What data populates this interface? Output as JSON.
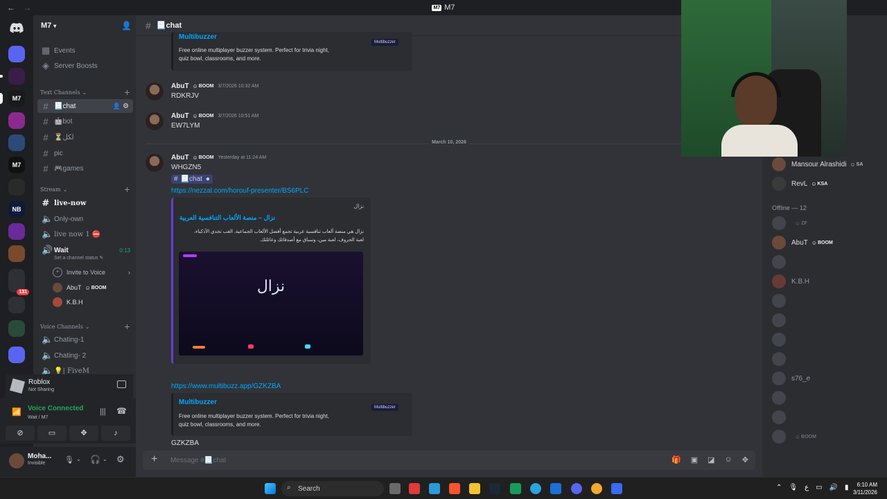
{
  "window": {
    "title": "M7",
    "back": "←",
    "forward": "→"
  },
  "server": {
    "name": "M7"
  },
  "sidebar": {
    "top_items": [
      {
        "label": "Events"
      },
      {
        "label": "Server Boosts"
      }
    ],
    "text_category": "Text Channels",
    "text_channels": [
      {
        "label": "📃chat"
      },
      {
        "label": "🤖bot"
      },
      {
        "label": "⏳لكل"
      },
      {
        "label": "pic"
      },
      {
        "label": "🎮games"
      }
    ],
    "stream_category": "Stream",
    "stream_channels": [
      {
        "label": "live-now"
      },
      {
        "label": "Only-own"
      },
      {
        "label": "live now 1 ⛔"
      },
      {
        "label": "Wait",
        "timer": "0:13"
      }
    ],
    "channel_status": "Set a channel status ✎",
    "invite_to_voice": "Invite to Voice",
    "voice_users": [
      {
        "name": "AbuT",
        "tag": "BOOM"
      },
      {
        "name": "K.B.H"
      }
    ],
    "voice_category": "Voice Channels",
    "voice_channels": [
      {
        "label": "Chating-1"
      },
      {
        "label": "Chating- 2"
      },
      {
        "label": "💡| FiveM"
      }
    ]
  },
  "activity": {
    "title": "Roblox",
    "status": "Not Sharing"
  },
  "voice": {
    "status": "Voice Connected",
    "location": "Wait / M7"
  },
  "user": {
    "name": "Moha...",
    "status": "Invisible"
  },
  "chat": {
    "channel": "📃chat",
    "top_embed": {
      "title": "Multibuzzer",
      "desc1": "Free online multiplayer buzzer system. Perfect for trivia night,",
      "desc2": "quiz bowl, classrooms, and more.",
      "logo": "Multibuzzer"
    },
    "messages": [
      {
        "author": "AbuT",
        "tag": "BOOM",
        "time": "3/7/2026 10:32 AM",
        "text": "RDKRJV"
      },
      {
        "author": "AbuT",
        "tag": "BOOM",
        "time": "3/7/2026 10:51 AM",
        "text": "EW7LYM"
      },
      {
        "author": "AbuT",
        "tag": "BOOM",
        "time": "Yesterday at 11:24 AM",
        "text": "WHGZN5"
      }
    ],
    "date_divider": "March 10, 2026",
    "channel_mention": "📃chat",
    "link1": "https://nezzal.com/horouf-presenter/BS6PLC",
    "nezzal_embed": {
      "provider": "نزال",
      "title": "نزال – منصة الألعاب التنافسية العربية",
      "desc1": "نزال هي منصة ألعاب تنافسية عربية تجمع أفضل الألعاب الجماعية. العب تحدي الأذكياء،",
      "desc2": "لعبة الحروف، لعبة مين، وسباق مع أصدقائك وعائلتك.",
      "image_text": "نزال"
    },
    "link2": "https://www.multibuzz.app/GZKZBA",
    "bottom_embed": {
      "title": "Multibuzzer",
      "desc1": "Free online multiplayer buzzer system. Perfect for trivia night,",
      "desc2": "quiz bowl, classrooms, and more.",
      "logo": "Multibuzzer"
    },
    "last_text": "GZKZBA",
    "composer_placeholder": "Message #📃chat"
  },
  "members": {
    "online": [
      {
        "name": "Mansour Alrashidi",
        "tag": "SA"
      },
      {
        "name": "RevL",
        "tag": "KSA"
      }
    ],
    "offline_header": "Offline — 12",
    "offline": [
      {
        "name": "",
        "tag": "ZF"
      },
      {
        "name": "AbuT",
        "tag": "BOOM",
        "highlight": true
      },
      {
        "name": ""
      },
      {
        "name": "K.B.H"
      },
      {
        "name": ""
      },
      {
        "name": ""
      },
      {
        "name": ""
      },
      {
        "name": ""
      },
      {
        "name": "s76_e"
      },
      {
        "name": ""
      },
      {
        "name": ""
      },
      {
        "name": "",
        "tag": "BOOM"
      }
    ]
  },
  "taskbar": {
    "search": "Search",
    "time": "6:10 AM",
    "date": "3/11/2026",
    "lang": "ع"
  }
}
